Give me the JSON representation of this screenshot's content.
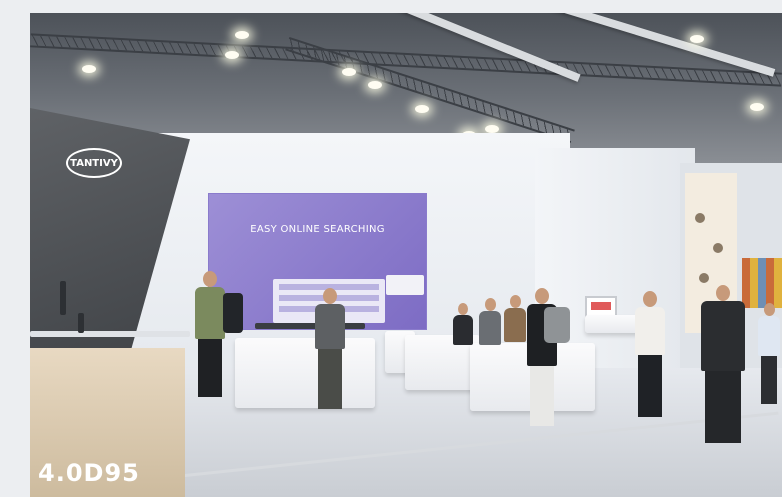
{
  "scene": {
    "booth_logo_text": "TANTIVY",
    "screen_headline": "EASY ONLINE SEARCHING",
    "counter_brand_text": "4.0D95"
  },
  "colors": {
    "screen": "#8f80d0",
    "dark_wall": "#4a4d52",
    "counter_wood": "#d8c7ab",
    "floor": "#dfe2e7"
  }
}
